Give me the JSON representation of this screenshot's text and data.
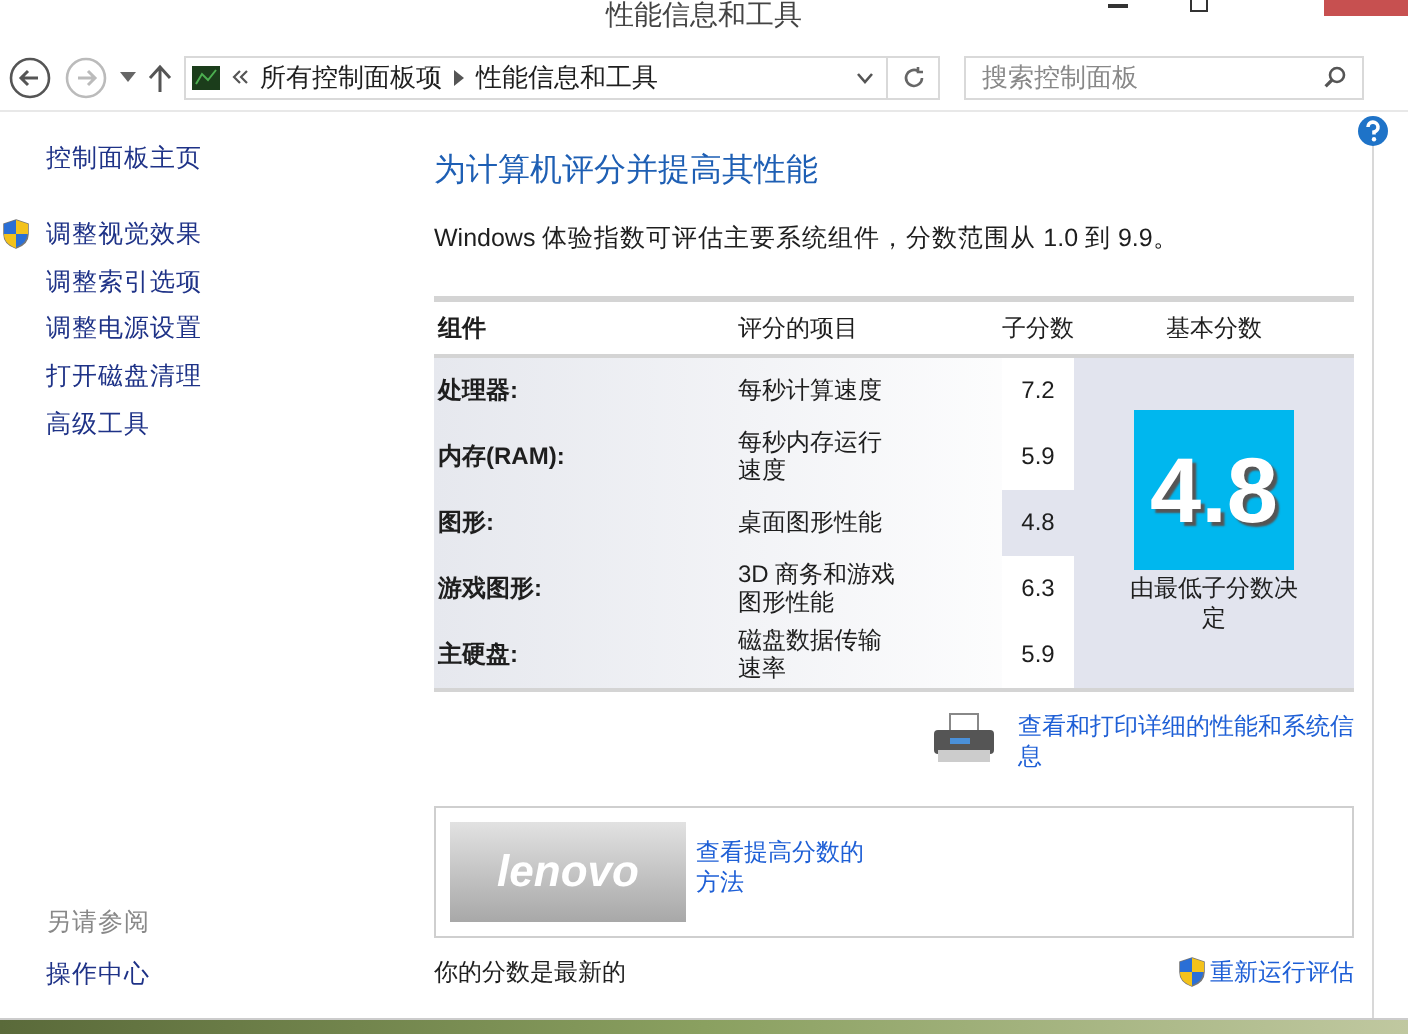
{
  "window": {
    "title": "性能信息和工具"
  },
  "nav": {
    "breadcrumb": [
      "所有控制面板项",
      "性能信息和工具"
    ],
    "search": {
      "placeholder": "搜索控制面板"
    }
  },
  "sidebar": {
    "home": "控制面板主页",
    "items": [
      {
        "label": "调整视觉效果",
        "shield": true
      },
      {
        "label": "调整索引选项",
        "shield": false
      },
      {
        "label": "调整电源设置",
        "shield": false
      },
      {
        "label": "打开磁盘清理",
        "shield": false
      },
      {
        "label": "高级工具",
        "shield": false
      }
    ],
    "see_also": {
      "heading": "另请参阅",
      "links": [
        "操作中心"
      ]
    }
  },
  "main": {
    "heading": "为计算机评分并提高其性能",
    "intro": "Windows 体验指数可评估主要系统组件，分数范围从 1.0 到 9.9。",
    "table": {
      "columns": [
        "组件",
        "评分的项目",
        "子分数",
        "基本分数"
      ],
      "rows": [
        {
          "component": "处理器:",
          "item": "每秒计算速度",
          "score": "7.2",
          "lowest": false
        },
        {
          "component": "内存(RAM):",
          "item": "每秒内存运行速度",
          "score": "5.9",
          "lowest": false
        },
        {
          "component": "图形:",
          "item": "桌面图形性能",
          "score": "4.8",
          "lowest": true
        },
        {
          "component": "游戏图形:",
          "item": "3D 商务和游戏图形性能",
          "score": "6.3",
          "lowest": false
        },
        {
          "component": "主硬盘:",
          "item": "磁盘数据传输速率",
          "score": "5.9",
          "lowest": false
        }
      ],
      "base_score": "4.8",
      "base_note": "由最低子分数决定"
    },
    "print_link": "查看和打印详细的性能和系统信息",
    "promo": {
      "logo": "lenovo",
      "link": "查看提高分数的方法"
    },
    "status": "你的分数是最新的",
    "rerun": "重新运行评估"
  }
}
